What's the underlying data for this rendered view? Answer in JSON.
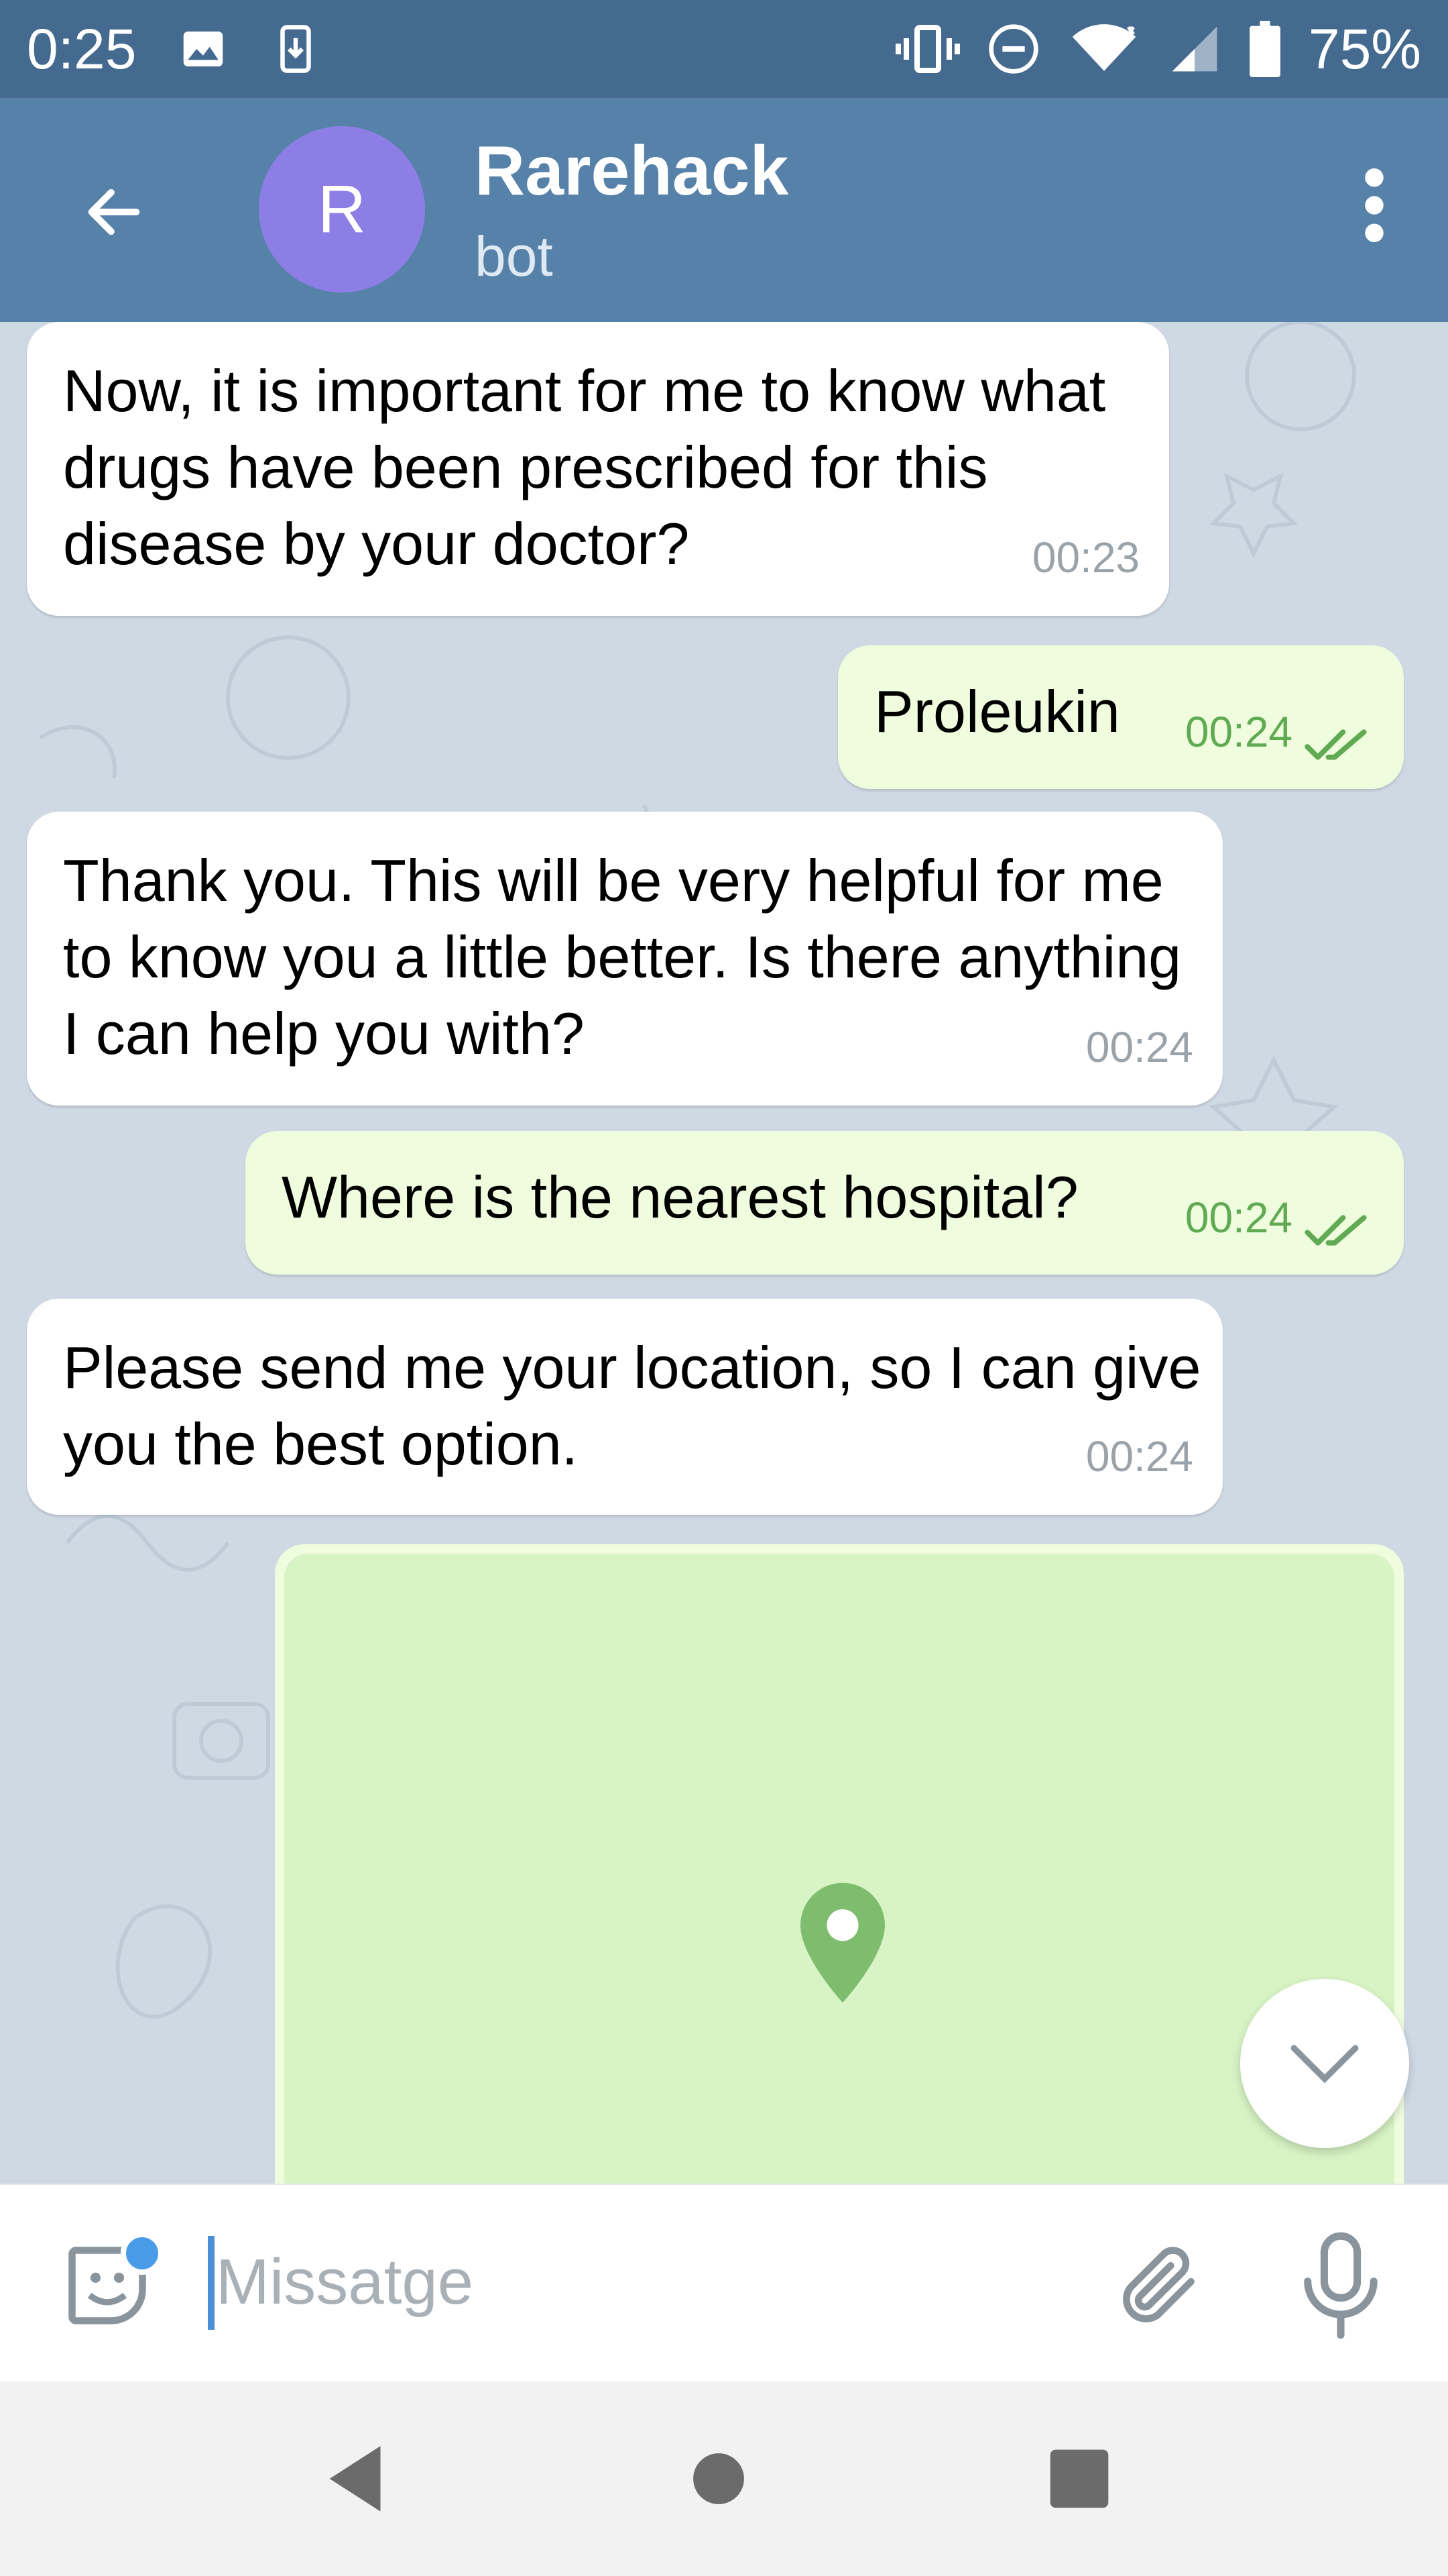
{
  "status_bar": {
    "time": "0:25",
    "battery_percent": "75%",
    "icons": [
      "image-icon",
      "download-icon",
      "vibrate-icon",
      "dnd-icon",
      "wifi-icon",
      "signal-icon",
      "battery-icon"
    ]
  },
  "header": {
    "avatar_letter": "R",
    "title": "Rarehack",
    "subtitle": "bot",
    "avatar_color": "#8d7ee6",
    "header_color": "#5681a9"
  },
  "messages": [
    {
      "direction": "in",
      "text": "Now, it is important for me to know what drugs have been prescribed for this disease by your doctor?",
      "time": "00:23"
    },
    {
      "direction": "out",
      "text": "Proleukin",
      "time": "00:24"
    },
    {
      "direction": "in",
      "text": "Thank you. This will be very helpful for me to know you a little better. Is there anything I can help you with?",
      "time": "00:24"
    },
    {
      "direction": "out",
      "text": "Where is the nearest hospital?",
      "time": "00:24"
    },
    {
      "direction": "in",
      "text": "Please send me your location, so I can give you the best option.",
      "time": "00:24"
    }
  ],
  "location_message": {
    "type": "map",
    "pin_icon": "map-pin-icon"
  },
  "input": {
    "placeholder": "Missatge"
  },
  "colors": {
    "incoming_bubble": "#ffffff",
    "outgoing_bubble": "#effdde",
    "chat_background": "#cfd9e3",
    "read_ticks": "#5faa52"
  }
}
